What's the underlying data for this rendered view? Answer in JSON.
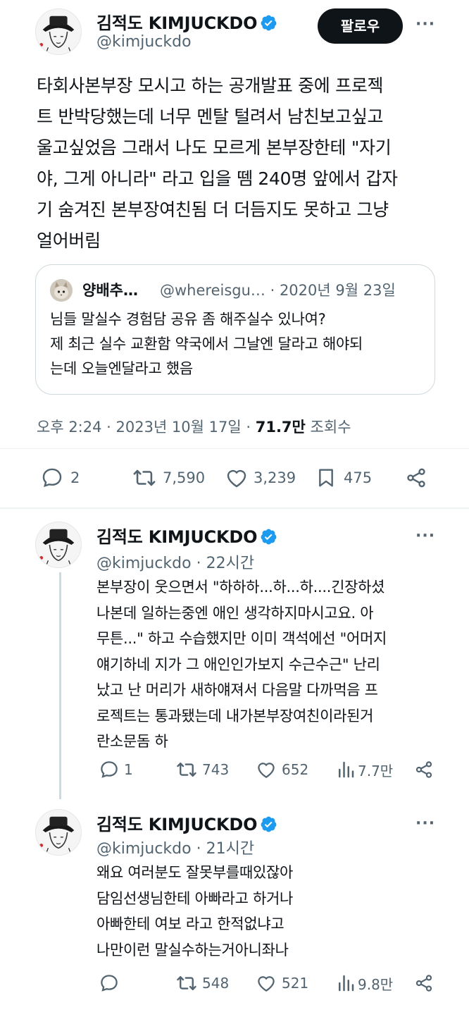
{
  "main_tweet": {
    "author_name": "김적도 KIMJUCKDO",
    "handle": "@kimjuckdo",
    "follow_label": "팔로우",
    "more_label": "···",
    "lines": [
      "타회사본부장 모시고 하는 공개발표 중에 프로젝",
      "트 반박당했는데 너무 멘탈 털려서 남친보고싶고",
      "울고싶었음 그래서 나도 모르게 본부장한테 \"자기",
      "야, 그게 아니라\" 라고 입을 뗌 240명 앞에서 갑자",
      "기 숨겨진 본부장여친됨  더 더듬지도 못하고 그냥",
      "얼어버림"
    ],
    "quote": {
      "author_name": "양배추…",
      "handle_date": "@whereisgu… · 2020년 9월 23일",
      "lines": [
        "님들 말실수 경험담 공유 좀 해주실수 있나여?",
        "제 최근 실수 교환함 약국에서 그날엔 달라고 해야되",
        "는데 오늘엔달라고 했음"
      ]
    },
    "timestamp": "오후 2:24 · 2023년 10월 17일 · ",
    "views_value": "71.7만",
    "views_label": " 조회수",
    "stats": {
      "replies": "2",
      "retweets": "7,590",
      "likes": "3,239",
      "bookmarks": "475"
    }
  },
  "replies": [
    {
      "author_name": "김적도 KIMJUCKDO",
      "handle_time": "@kimjuckdo · 22시간",
      "more_label": "···",
      "lines": [
        "본부장이 웃으면서 \"하하하...하...하....긴장하셨",
        "나본데 일하는중엔 애인 생각하지마시고요. 아",
        "무튼...\" 하고 수습했지만 이미 객석에선 \"어머지",
        "얘기하네 지가 그 애인인가보지 수근수근\" 난리",
        "났고 난 머리가 새하얘져서 다음말 다까먹음 프",
        "로젝트는 통과됐는데 내가본부장여친이라된거",
        "란소문돔 하"
      ],
      "stats": {
        "replies": "1",
        "retweets": "743",
        "likes": "652",
        "views": "7.7만"
      }
    },
    {
      "author_name": "김적도 KIMJUCKDO",
      "handle_time": "@kimjuckdo · 21시간",
      "more_label": "···",
      "lines": [
        "왜요 여러분도 잘못부를때있잖아",
        "담임선생님한테 아빠라고 하거나",
        "아빠한테 여보 라고 한적없냐고",
        "나만이런 말실수하는거아니좌나"
      ],
      "stats": {
        "replies": "",
        "retweets": "548",
        "likes": "521",
        "views": "9.8만"
      }
    }
  ],
  "colors": {
    "text": "#0f1419",
    "secondary": "#536471",
    "verified": "#1d9bf0",
    "border": "#cfd9de"
  },
  "icons": [
    "reply-icon",
    "retweet-icon",
    "like-icon",
    "bookmark-icon",
    "share-icon",
    "views-icon",
    "verified-badge-icon"
  ]
}
